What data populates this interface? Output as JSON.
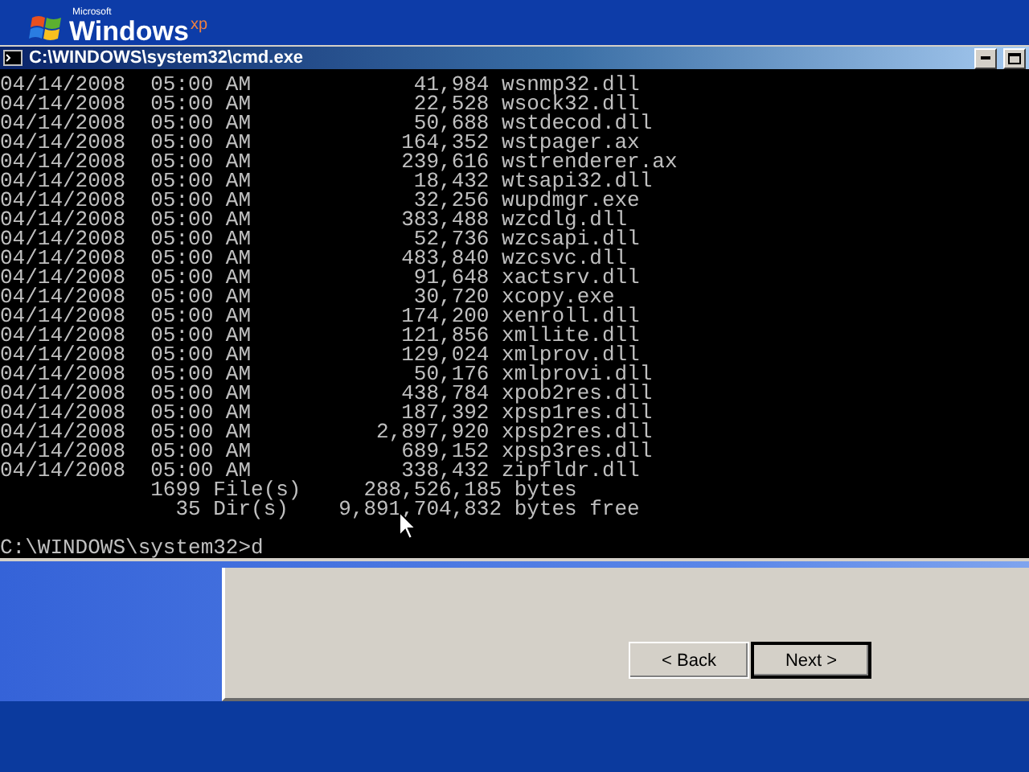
{
  "desktop_logo": {
    "brand": "Microsoft",
    "name": "Windows",
    "edition": "xp"
  },
  "console": {
    "title": "C:\\WINDOWS\\system32\\cmd.exe",
    "rows": [
      {
        "date": "04/14/2008",
        "time": "05:00 AM",
        "size": "41,984",
        "name": "wsnmp32.dll"
      },
      {
        "date": "04/14/2008",
        "time": "05:00 AM",
        "size": "22,528",
        "name": "wsock32.dll"
      },
      {
        "date": "04/14/2008",
        "time": "05:00 AM",
        "size": "50,688",
        "name": "wstdecod.dll"
      },
      {
        "date": "04/14/2008",
        "time": "05:00 AM",
        "size": "164,352",
        "name": "wstpager.ax"
      },
      {
        "date": "04/14/2008",
        "time": "05:00 AM",
        "size": "239,616",
        "name": "wstrenderer.ax"
      },
      {
        "date": "04/14/2008",
        "time": "05:00 AM",
        "size": "18,432",
        "name": "wtsapi32.dll"
      },
      {
        "date": "04/14/2008",
        "time": "05:00 AM",
        "size": "32,256",
        "name": "wupdmgr.exe"
      },
      {
        "date": "04/14/2008",
        "time": "05:00 AM",
        "size": "383,488",
        "name": "wzcdlg.dll"
      },
      {
        "date": "04/14/2008",
        "time": "05:00 AM",
        "size": "52,736",
        "name": "wzcsapi.dll"
      },
      {
        "date": "04/14/2008",
        "time": "05:00 AM",
        "size": "483,840",
        "name": "wzcsvc.dll"
      },
      {
        "date": "04/14/2008",
        "time": "05:00 AM",
        "size": "91,648",
        "name": "xactsrv.dll"
      },
      {
        "date": "04/14/2008",
        "time": "05:00 AM",
        "size": "30,720",
        "name": "xcopy.exe"
      },
      {
        "date": "04/14/2008",
        "time": "05:00 AM",
        "size": "174,200",
        "name": "xenroll.dll"
      },
      {
        "date": "04/14/2008",
        "time": "05:00 AM",
        "size": "121,856",
        "name": "xmllite.dll"
      },
      {
        "date": "04/14/2008",
        "time": "05:00 AM",
        "size": "129,024",
        "name": "xmlprov.dll"
      },
      {
        "date": "04/14/2008",
        "time": "05:00 AM",
        "size": "50,176",
        "name": "xmlprovi.dll"
      },
      {
        "date": "04/14/2008",
        "time": "05:00 AM",
        "size": "438,784",
        "name": "xpob2res.dll"
      },
      {
        "date": "04/14/2008",
        "time": "05:00 AM",
        "size": "187,392",
        "name": "xpsp1res.dll"
      },
      {
        "date": "04/14/2008",
        "time": "05:00 AM",
        "size": "2,897,920",
        "name": "xpsp2res.dll"
      },
      {
        "date": "04/14/2008",
        "time": "05:00 AM",
        "size": "689,152",
        "name": "xpsp3res.dll"
      },
      {
        "date": "04/14/2008",
        "time": "05:00 AM",
        "size": "338,432",
        "name": "zipfldr.dll"
      }
    ],
    "summary": [
      {
        "count": "1699",
        "label": "File(s)",
        "size": "288,526,185",
        "unit": "bytes"
      },
      {
        "count": "35",
        "label": "Dir(s)",
        "size": "9,891,704,832",
        "unit": "bytes free"
      }
    ],
    "prompt": "C:\\WINDOWS\\system32>d"
  },
  "wizard": {
    "buttons": [
      {
        "label": "< Back",
        "default": false
      },
      {
        "label": "Next >",
        "default": true
      }
    ]
  }
}
